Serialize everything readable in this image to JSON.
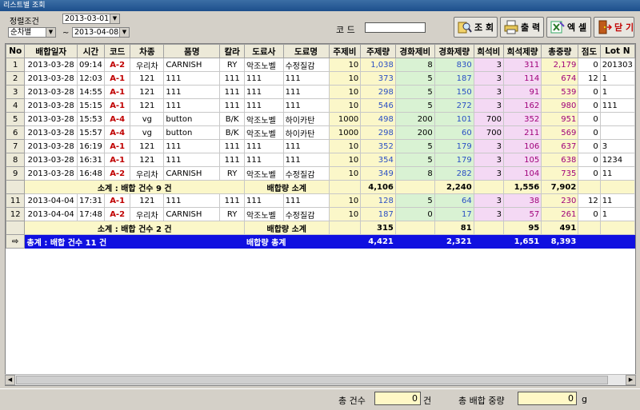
{
  "window": {
    "title": "리스트별 조회"
  },
  "filters": {
    "sort_label": "정렬조건",
    "sort_value": "순차별",
    "date_from": "2013-03-01",
    "date_sep": "~",
    "date_to": "2013-04-08",
    "code_label": "코 드",
    "code_value": ""
  },
  "toolbar": {
    "search_label": "조 회",
    "print_label": "출 력",
    "excel_label": "엑 셀",
    "close_label": "닫 기"
  },
  "grid": {
    "columns": [
      "No",
      "배합일자",
      "시간",
      "코드",
      "차종",
      "품명",
      "칼라",
      "도료사",
      "도료명",
      "주제비",
      "주제량",
      "경화제비",
      "경화제량",
      "희석비",
      "희석제량",
      "총중량",
      "점도",
      "Lot N"
    ],
    "rows": [
      {
        "type": "data",
        "no": "1",
        "date": "2013-03-28",
        "time": "09:14",
        "code": "A-2",
        "car": "우리차",
        "item": "CARNISH",
        "color": "RY",
        "maker": "악조노벨",
        "paint": "수정질감",
        "r1": "10",
        "q1": "1,038",
        "r2": "8",
        "q2": "830",
        "r3": "3",
        "q3": "311",
        "total": "2,179",
        "visc": "0",
        "lot": "201303"
      },
      {
        "type": "data",
        "no": "2",
        "date": "2013-03-28",
        "time": "12:03",
        "code": "A-1",
        "car": "121",
        "item": "111",
        "color": "111",
        "maker": "111",
        "paint": "111",
        "r1": "10",
        "q1": "373",
        "r2": "5",
        "q2": "187",
        "r3": "3",
        "q3": "114",
        "total": "674",
        "visc": "12",
        "lot": "1"
      },
      {
        "type": "data",
        "no": "3",
        "date": "2013-03-28",
        "time": "14:55",
        "code": "A-1",
        "car": "121",
        "item": "111",
        "color": "111",
        "maker": "111",
        "paint": "111",
        "r1": "10",
        "q1": "298",
        "r2": "5",
        "q2": "150",
        "r3": "3",
        "q3": "91",
        "total": "539",
        "visc": "0",
        "lot": "1"
      },
      {
        "type": "data",
        "no": "4",
        "date": "2013-03-28",
        "time": "15:15",
        "code": "A-1",
        "car": "121",
        "item": "111",
        "color": "111",
        "maker": "111",
        "paint": "111",
        "r1": "10",
        "q1": "546",
        "r2": "5",
        "q2": "272",
        "r3": "3",
        "q3": "162",
        "total": "980",
        "visc": "0",
        "lot": "111"
      },
      {
        "type": "data",
        "no": "5",
        "date": "2013-03-28",
        "time": "15:53",
        "code": "A-4",
        "car": "vg",
        "item": "button",
        "color": "B/K",
        "maker": "악조노벨",
        "paint": "하이카탄",
        "r1": "1000",
        "q1": "498",
        "r2": "200",
        "q2": "101",
        "r3": "700",
        "q3": "352",
        "total": "951",
        "visc": "0",
        "lot": ""
      },
      {
        "type": "data",
        "no": "6",
        "date": "2013-03-28",
        "time": "15:57",
        "code": "A-4",
        "car": "vg",
        "item": "button",
        "color": "B/K",
        "maker": "악조노벨",
        "paint": "하이카탄",
        "r1": "1000",
        "q1": "298",
        "r2": "200",
        "q2": "60",
        "r3": "700",
        "q3": "211",
        "total": "569",
        "visc": "0",
        "lot": ""
      },
      {
        "type": "data",
        "no": "7",
        "date": "2013-03-28",
        "time": "16:19",
        "code": "A-1",
        "car": "121",
        "item": "111",
        "color": "111",
        "maker": "111",
        "paint": "111",
        "r1": "10",
        "q1": "352",
        "r2": "5",
        "q2": "179",
        "r3": "3",
        "q3": "106",
        "total": "637",
        "visc": "0",
        "lot": "3"
      },
      {
        "type": "data",
        "no": "8",
        "date": "2013-03-28",
        "time": "16:31",
        "code": "A-1",
        "car": "121",
        "item": "111",
        "color": "111",
        "maker": "111",
        "paint": "111",
        "r1": "10",
        "q1": "354",
        "r2": "5",
        "q2": "179",
        "r3": "3",
        "q3": "105",
        "total": "638",
        "visc": "0",
        "lot": "1234"
      },
      {
        "type": "data",
        "no": "9",
        "date": "2013-03-28",
        "time": "16:48",
        "code": "A-2",
        "car": "우리차",
        "item": "CARNISH",
        "color": "RY",
        "maker": "악조노벨",
        "paint": "수정질감",
        "r1": "10",
        "q1": "349",
        "r2": "8",
        "q2": "282",
        "r3": "3",
        "q3": "104",
        "total": "735",
        "visc": "0",
        "lot": "11"
      },
      {
        "type": "sub",
        "label1": "소계 : 배합 건수  9 건",
        "label2": "배합량 소계",
        "q1": "4,106",
        "q2": "2,240",
        "q3": "1,556",
        "total": "7,902"
      },
      {
        "type": "data",
        "no": "11",
        "date": "2013-04-04",
        "time": "17:31",
        "code": "A-1",
        "car": "121",
        "item": "111",
        "color": "111",
        "maker": "111",
        "paint": "111",
        "r1": "10",
        "q1": "128",
        "r2": "5",
        "q2": "64",
        "r3": "3",
        "q3": "38",
        "total": "230",
        "visc": "12",
        "lot": "11"
      },
      {
        "type": "data",
        "no": "12",
        "date": "2013-04-04",
        "time": "17:48",
        "code": "A-2",
        "car": "우리차",
        "item": "CARNISH",
        "color": "RY",
        "maker": "악조노벨",
        "paint": "수정질감",
        "r1": "10",
        "q1": "187",
        "r2": "0",
        "q2": "17",
        "r3": "3",
        "q3": "57",
        "total": "261",
        "visc": "0",
        "lot": "1"
      },
      {
        "type": "sub",
        "label1": "소계 : 배합 건수  2 건",
        "label2": "배합량 소계",
        "q1": "315",
        "q2": "81",
        "q3": "95",
        "total": "491"
      },
      {
        "type": "tot",
        "label1": "총계 : 배합 건수  11 건",
        "label2": "배합량 총계",
        "q1": "4,421",
        "q2": "2,321",
        "q3": "1,651",
        "total": "8,393"
      }
    ]
  },
  "footer": {
    "count_label": "총 건수",
    "count_value": "0",
    "count_unit": "건",
    "weight_label": "총 배합 중량",
    "weight_value": "0",
    "weight_unit": "g"
  }
}
